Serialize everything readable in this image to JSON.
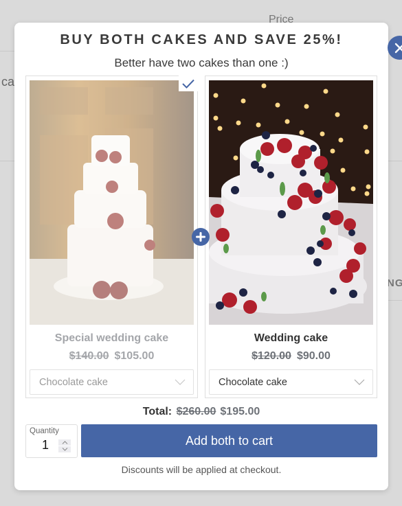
{
  "background": {
    "price_header": "Price",
    "left_fragment": "ca",
    "right_fragment": "NG"
  },
  "modal": {
    "title": "BUY BOTH CAKES AND SAVE 25%!",
    "subtitle": "Better have two cakes than one :)",
    "close_icon": "close-icon",
    "plus_icon": "plus-icon",
    "accent_color": "#4666a6",
    "products": [
      {
        "name": "Special wedding cake",
        "price_old": "$140.00",
        "price_new": "$105.00",
        "variant": "Chocolate cake",
        "selected": true,
        "image": "tiered-wedding-cake-with-red-roses"
      },
      {
        "name": "Wedding cake",
        "price_old": "$120.00",
        "price_new": "$90.00",
        "variant": "Chocolate cake",
        "selected": false,
        "image": "white-cake-with-berries"
      }
    ],
    "total": {
      "label": "Total:",
      "old": "$260.00",
      "new": "$195.00"
    },
    "quantity": {
      "label": "Quantity",
      "value": "1"
    },
    "add_button_label": "Add both to cart",
    "note": "Discounts will be applied at checkout."
  }
}
